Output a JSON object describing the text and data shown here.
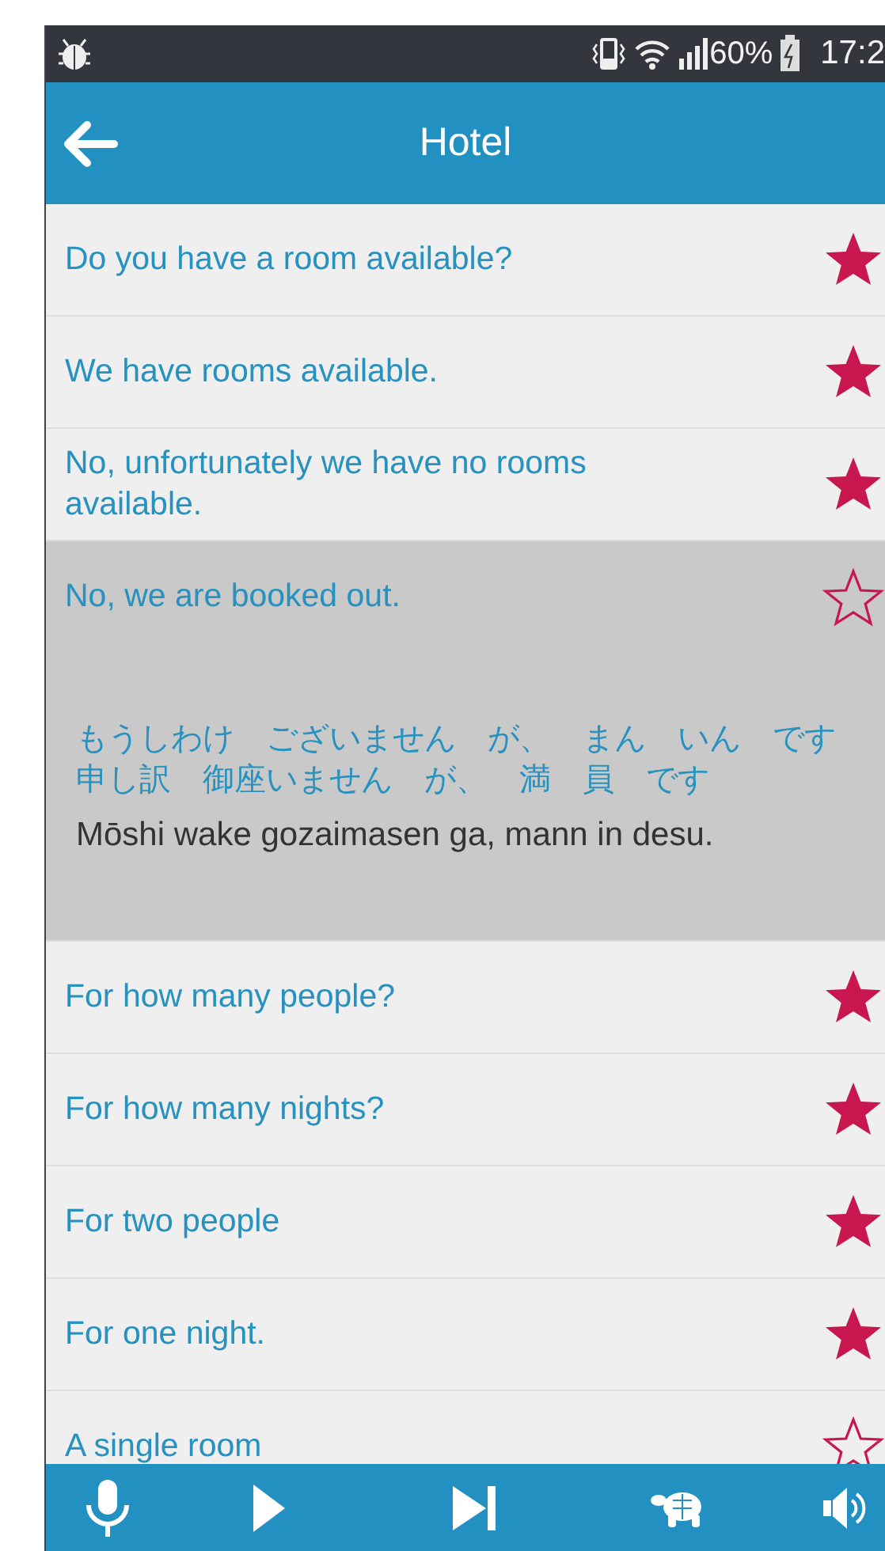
{
  "status_bar": {
    "battery": "60%",
    "time": "17:2"
  },
  "app_bar": {
    "title": "Hotel"
  },
  "phrases": [
    {
      "text": "Do you have a room available?",
      "starred": true,
      "expanded": false
    },
    {
      "text": "We have rooms available.",
      "starred": true,
      "expanded": false
    },
    {
      "text": "No, unfortunately we have no rooms available.",
      "starred": true,
      "expanded": false
    },
    {
      "text": "No, we are booked out.",
      "starred": false,
      "expanded": true,
      "kana": "もうしわけ　ございません　が、　まん　いん　です",
      "kanji": "申し訳　御座いません　が、　満　員　です",
      "romaji": "Mōshi wake gozaimasen ga, mann in desu."
    },
    {
      "text": "For how many people?",
      "starred": true,
      "expanded": false
    },
    {
      "text": "For how many nights?",
      "starred": true,
      "expanded": false
    },
    {
      "text": "For two people",
      "starred": true,
      "expanded": false
    },
    {
      "text": "For one night.",
      "starred": true,
      "expanded": false
    },
    {
      "text": "A single room",
      "starred": false,
      "expanded": false
    }
  ]
}
